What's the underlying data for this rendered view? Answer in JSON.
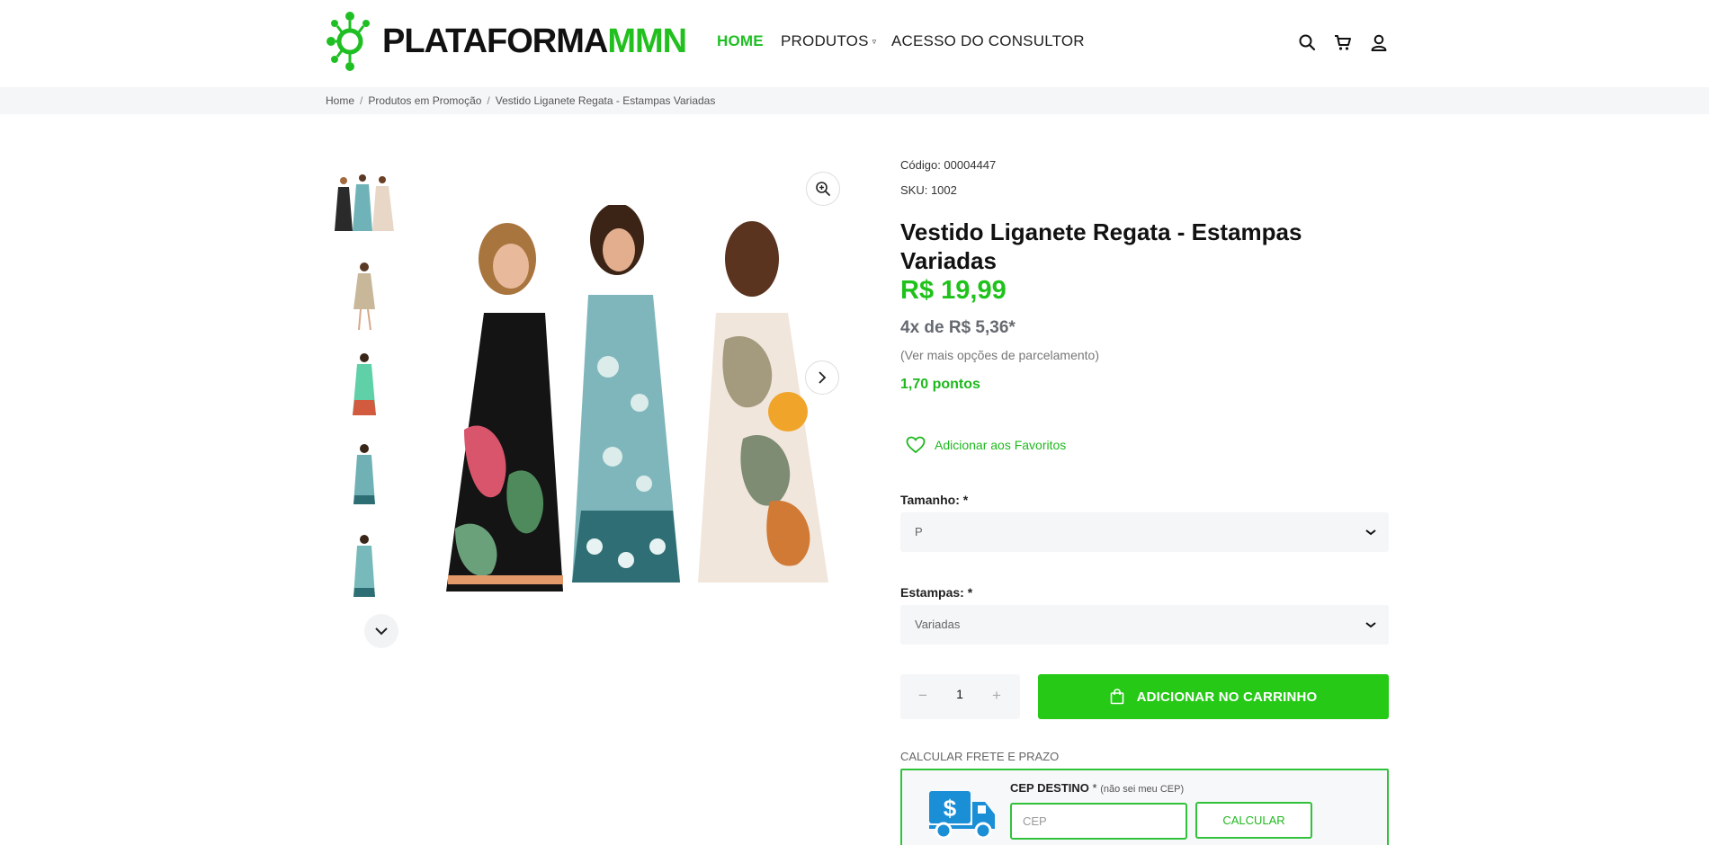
{
  "header": {
    "logo_text_main": "PLATAFORMA",
    "logo_text_accent": "MMN",
    "nav": {
      "home": "HOME",
      "produtos": "PRODUTOS",
      "consultor": "ACESSO DO CONSULTOR"
    },
    "icons": [
      "search-icon",
      "cart-icon",
      "user-icon"
    ]
  },
  "breadcrumb": {
    "items": [
      "Home",
      "Produtos em Promoção",
      "Vestido Liganete Regata - Estampas Variadas"
    ],
    "separator": "/"
  },
  "product": {
    "codigo": "Código: 00004447",
    "sku": "SKU: 1002",
    "title": "Vestido Liganete Regata - Estampas Variadas",
    "price": "R$ 19,99",
    "installments": "4x de R$ 5,36*",
    "more_options": "(Ver mais opções de parcelamento)",
    "points": "1,70 pontos",
    "favorite_label": "Adicionar aos Favoritos",
    "size_label": "Tamanho: *",
    "size_value": "P",
    "print_label": "Estampas: *",
    "print_value": "Variadas",
    "quantity": "1",
    "qty_minus": "−",
    "qty_plus": "+",
    "add_to_cart": "ADICIONAR NO CARRINHO"
  },
  "shipping": {
    "title": "CALCULAR FRETE E PRAZO",
    "cep_label": "CEP DESTINO",
    "cep_required": "*",
    "cep_help": "(não sei meu CEP)",
    "cep_placeholder": "CEP",
    "calc_button": "CALCULAR"
  },
  "colors": {
    "accent_green": "#25c916",
    "price_green": "#1fc21a",
    "dark_text": "#111111",
    "breadcrumb_bg": "#f5f6f8",
    "truck_blue": "#1a8fd6"
  }
}
